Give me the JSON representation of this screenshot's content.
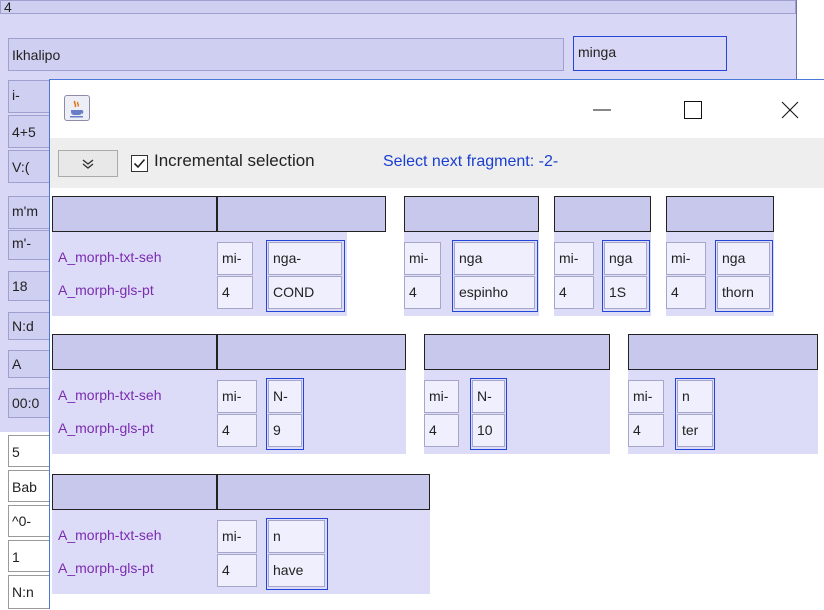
{
  "background": {
    "top_cell": "4",
    "name_cell": "Ikhalipo",
    "field_value": "minga",
    "left_cells": [
      "i-",
      "4+5",
      "V:(",
      "m'm",
      "m'-",
      "18",
      "N:d",
      "A",
      "00:0"
    ],
    "lower_cells": [
      "5",
      "Bab",
      "^0-",
      "1",
      "N:n"
    ]
  },
  "dialog": {
    "icon": "java-coffee-cup-icon",
    "window_controls": [
      "minimize-icon",
      "maximize-icon",
      "close-icon"
    ],
    "toolbar": {
      "dropdown_icon": "chevron-down-icon",
      "checkbox_checked": true,
      "checkbox_label": "Incremental selection",
      "status": "Select next fragment: -2-"
    },
    "tier_names": [
      "A_morph-txt-seh",
      "A_morph-gls-pt"
    ],
    "colors": {
      "tier_label": "#7b2bb0",
      "selection": "#2346d8",
      "status": "#1a3ed0"
    },
    "fragment_rows": [
      [
        {
          "label_col": true,
          "cells": [
            [
              "mi-",
              "4"
            ],
            [
              "nga-",
              "COND"
            ]
          ]
        },
        {
          "label_col": false,
          "cells": [
            [
              "mi-",
              "4"
            ],
            [
              "nga",
              "espinho"
            ]
          ]
        },
        {
          "label_col": false,
          "cells": [
            [
              "mi-",
              "4"
            ],
            [
              "nga",
              "1S"
            ]
          ]
        },
        {
          "label_col": false,
          "cells": [
            [
              "mi-",
              "4"
            ],
            [
              "nga",
              "thorn"
            ]
          ]
        }
      ],
      [
        {
          "label_col": true,
          "cells": [
            [
              "mi-",
              "4"
            ],
            [
              "N-",
              "9"
            ]
          ]
        },
        {
          "label_col": false,
          "cells": [
            [
              "mi-",
              "4"
            ],
            [
              "N-",
              "10"
            ]
          ]
        },
        {
          "label_col": false,
          "cells": [
            [
              "mi-",
              "4"
            ],
            [
              "n",
              "ter"
            ]
          ]
        }
      ],
      [
        {
          "label_col": true,
          "cells": [
            [
              "mi-",
              "4"
            ],
            [
              "n",
              "have"
            ]
          ]
        }
      ]
    ]
  }
}
